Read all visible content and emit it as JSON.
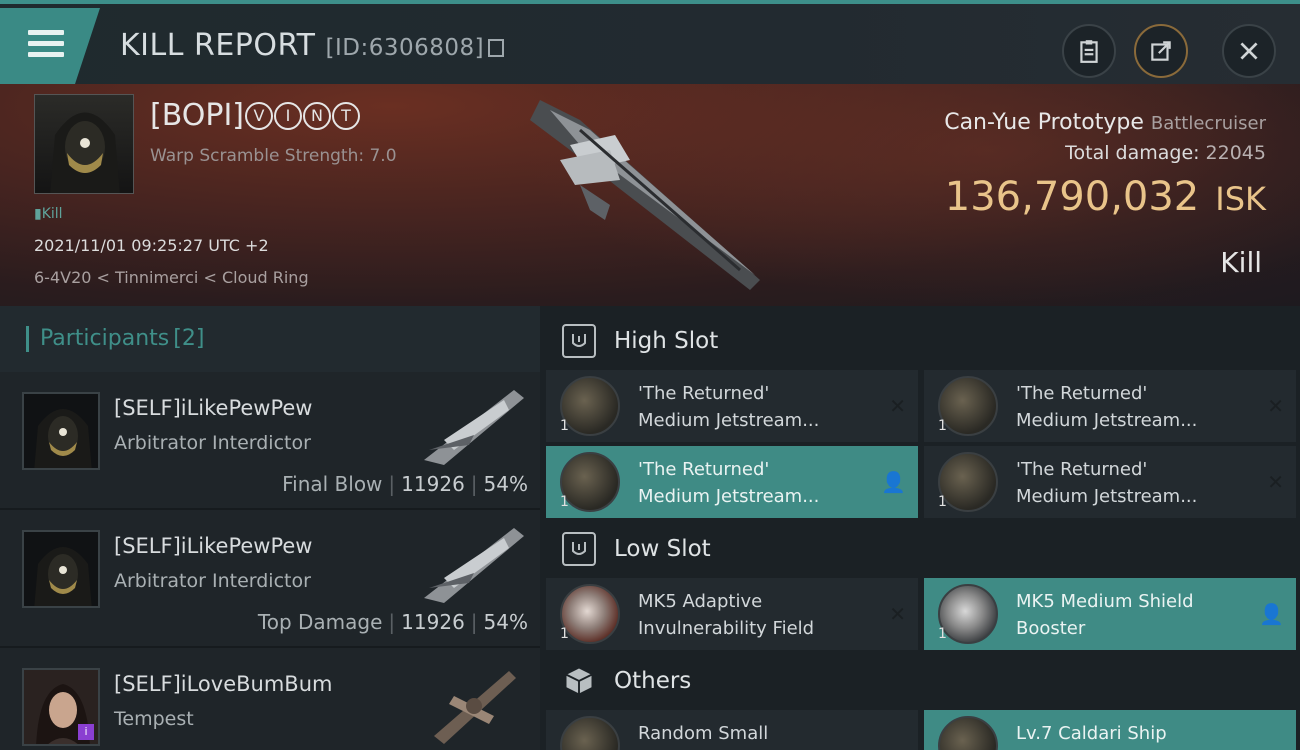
{
  "header": {
    "title": "KILL REPORT",
    "id_label": "[ID:6306808]"
  },
  "victim": {
    "name_prefix": "[BOPI]",
    "name_marks": [
      "V",
      "I",
      "N",
      "T"
    ],
    "warp_scramble": "Warp Scramble Strength: 7.0",
    "tag": "Kill",
    "datetime": "2021/11/01 09:25:27 UTC +2",
    "location": "6-4V20 < Tinnimerci < Cloud Ring"
  },
  "summary": {
    "ship_name": "Can-Yue Prototype",
    "ship_class": "Battlecruiser",
    "total_damage_label": "Total damage:",
    "total_damage_value": "22045",
    "isk_value": "136,790,032",
    "isk_unit": "ISK",
    "result": "Kill"
  },
  "participants": {
    "label": "Participants",
    "count": "[2]",
    "items": [
      {
        "name": "[SELF]iLikePewPew",
        "ship": "Arbitrator Interdictor",
        "role": "Final Blow",
        "damage": "11926",
        "percent": "54%"
      },
      {
        "name": "[SELF]iLikePewPew",
        "ship": "Arbitrator Interdictor",
        "role": "Top Damage",
        "damage": "11926",
        "percent": "54%"
      },
      {
        "name": "[SELF]iLoveBumBum",
        "ship": "Tempest",
        "badge": "i"
      }
    ]
  },
  "sections": {
    "high": "High Slot",
    "low": "Low Slot",
    "others": "Others"
  },
  "modules": {
    "high": [
      {
        "line1": "'The Returned'",
        "line2": "Medium Jetstream...",
        "qty": "1",
        "action": "✕"
      },
      {
        "line1": "'The Returned'",
        "line2": "Medium Jetstream...",
        "qty": "1",
        "action": "✕"
      },
      {
        "line1": "'The Returned'",
        "line2": "Medium Jetstream...",
        "qty": "1",
        "action": "👤"
      },
      {
        "line1": "'The Returned'",
        "line2": "Medium Jetstream...",
        "qty": "1",
        "action": "✕"
      }
    ],
    "low": [
      {
        "line1": "MK5 Adaptive",
        "line2": "Invulnerability Field",
        "qty": "1",
        "action": "✕"
      },
      {
        "line1": "MK5 Medium Shield",
        "line2": "Booster",
        "qty": "1",
        "action": "👤"
      }
    ],
    "others": [
      {
        "line1": "Random Small",
        "line2": ""
      },
      {
        "line1": "Lv.7 Caldari Ship",
        "line2": ""
      }
    ]
  },
  "colors": {
    "accent": "#3f8b85",
    "isk": "#e9c48a",
    "badge": "#8a3fd1"
  },
  "icons": {
    "menu": "hamburger-icon",
    "copy": "copy-icon",
    "report": "clipboard-icon",
    "share": "share-icon",
    "close": "close-icon"
  }
}
